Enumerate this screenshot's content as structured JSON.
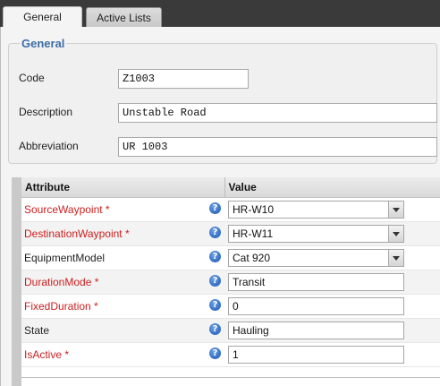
{
  "tabs": [
    {
      "label": "General",
      "active": true
    },
    {
      "label": "Active Lists",
      "active": false
    }
  ],
  "general": {
    "legend": "General",
    "fields": [
      {
        "label": "Code",
        "value": "Z1003"
      },
      {
        "label": "Description",
        "value": "Unstable Road"
      },
      {
        "label": "Abbreviation",
        "value": "UR 1003"
      }
    ]
  },
  "grid": {
    "headers": {
      "attribute": "Attribute",
      "value": "Value"
    },
    "help_glyph": "?",
    "rows": [
      {
        "name": "SourceWaypoint *",
        "required": true,
        "value": "HR-W10",
        "type": "select"
      },
      {
        "name": "DestinationWaypoint *",
        "required": true,
        "value": "HR-W11",
        "type": "select"
      },
      {
        "name": "EquipmentModel",
        "required": false,
        "value": "Cat 920",
        "type": "select"
      },
      {
        "name": "DurationMode *",
        "required": true,
        "value": "Transit",
        "type": "text"
      },
      {
        "name": "FixedDuration *",
        "required": true,
        "value": "0",
        "type": "text"
      },
      {
        "name": "State",
        "required": false,
        "value": "Hauling",
        "type": "text"
      },
      {
        "name": "IsActive *",
        "required": true,
        "value": "1",
        "type": "text"
      }
    ]
  },
  "colors": {
    "required_label": "#cc2020",
    "legend": "#3c6ea5",
    "help_icon": "#1d56b0"
  }
}
